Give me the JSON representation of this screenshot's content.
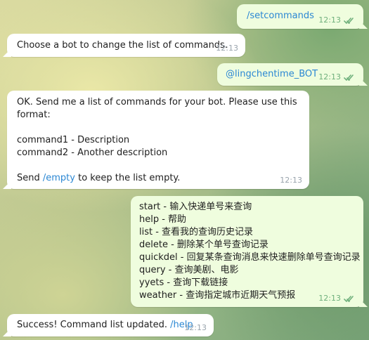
{
  "messages": {
    "m1": {
      "text": "/setcommands",
      "time": "12:13"
    },
    "m2": {
      "text": "Choose a bot to change the list of commands.",
      "time": "12:13"
    },
    "m3": {
      "text": "@lingchentime_BOT",
      "time": "12:13"
    },
    "m4": {
      "line1": "OK. Send me a list of commands for your bot. Please use this",
      "line2": "format:",
      "line3": "command1 - Description",
      "line4": "command2 - Another description",
      "line5_prefix": "Send ",
      "line5_link": "/empty",
      "line5_suffix": " to keep the list empty.",
      "time": "12:13"
    },
    "m5": {
      "lines": [
        "start - 输入快递单号来查询",
        "help - 帮助",
        "list - 查看我的查询历史记录",
        "delete - 删除某个单号查询记录",
        "quickdel - 回复某条查询消息来快速删除单号查询记录",
        "query - 查询美剧、电影",
        "yyets - 查询下载链接",
        "weather - 查询指定城市近期天气预报"
      ],
      "time": "12:13"
    },
    "m6": {
      "text": "Success! Command list updated. ",
      "link": "/help",
      "time": "12:13"
    }
  },
  "colors": {
    "outgoing_bubble": "#effdde",
    "incoming_bubble": "#ffffff",
    "link": "#2b87d3",
    "read_ticks": "#6fb07c"
  },
  "icons": {
    "read_status": "double-check-icon"
  }
}
